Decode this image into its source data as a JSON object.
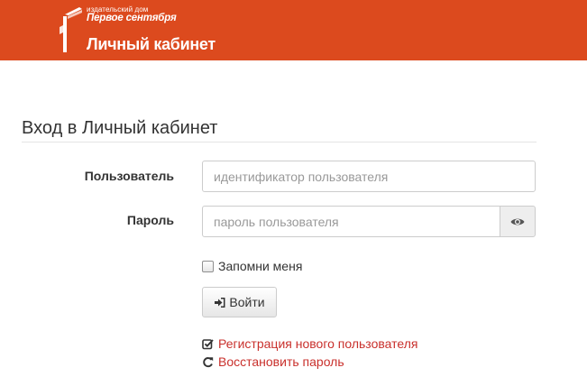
{
  "header": {
    "publisher_small": "издательский дом",
    "publisher_name": "Первое сентября",
    "cabinet_title": "Личный кабинет",
    "brand_color": "#dc4a1e"
  },
  "form": {
    "heading": "Вход в Личный кабинет",
    "username_label": "Пользователь",
    "username_placeholder": "идентификатор пользователя",
    "password_label": "Пароль",
    "password_placeholder": "пароль пользователя",
    "password_toggle_icon": "eye-icon",
    "remember_label": "Запомни меня",
    "remember_checked": false,
    "login_button_label": "Войти",
    "login_button_icon": "sign-in-icon"
  },
  "links": {
    "register_label": "Регистрация нового пользователя",
    "register_icon": "check-square-icon",
    "restore_label": "Восстановить пароль",
    "restore_icon": "refresh-icon",
    "link_color": "#c9302c"
  }
}
